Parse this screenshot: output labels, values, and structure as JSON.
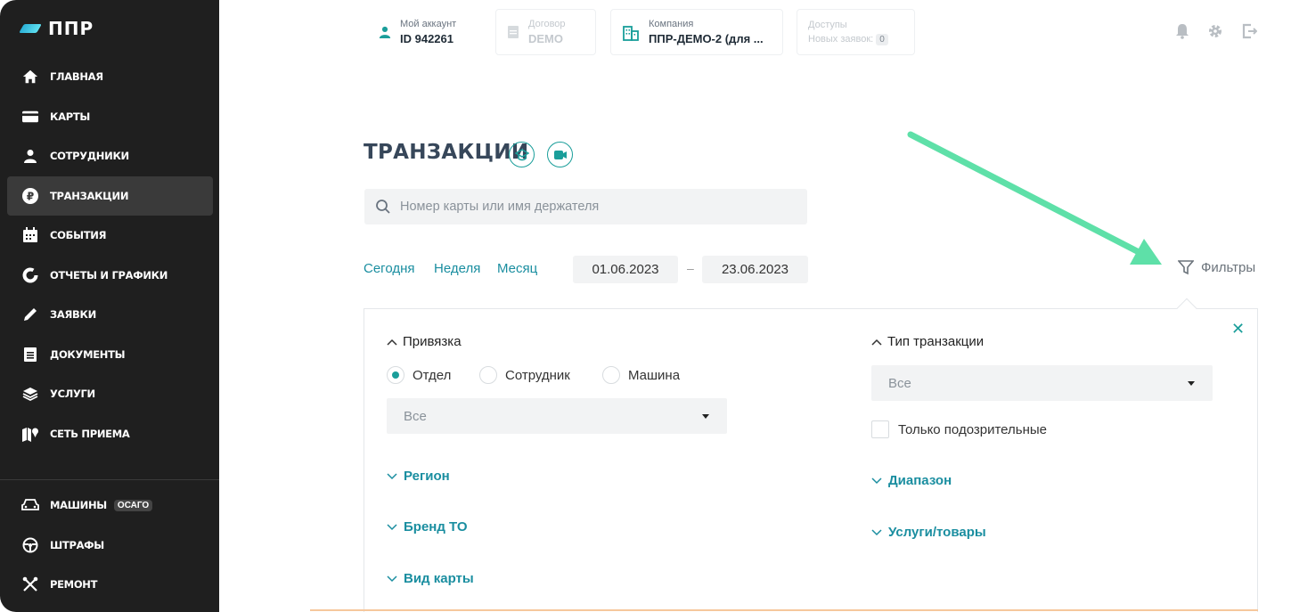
{
  "brand": {
    "logo_text": "ППР"
  },
  "sidebar": {
    "items": [
      {
        "label": "ГЛАВНАЯ",
        "icon": "home-icon"
      },
      {
        "label": "КАРТЫ",
        "icon": "card-icon"
      },
      {
        "label": "СОТРУДНИКИ",
        "icon": "user-icon"
      },
      {
        "label": "ТРАНЗАКЦИИ",
        "icon": "ruble-icon",
        "active": true
      },
      {
        "label": "СОБЫТИЯ",
        "icon": "calendar-icon"
      },
      {
        "label": "ОТЧЕТЫ И ГРАФИКИ",
        "icon": "donut-chart-icon"
      },
      {
        "label": "ЗАЯВКИ",
        "icon": "pencil-icon"
      },
      {
        "label": "ДОКУМЕНТЫ",
        "icon": "document-icon"
      },
      {
        "label": "УСЛУГИ",
        "icon": "layers-icon"
      },
      {
        "label": "СЕТЬ ПРИЕМА",
        "icon": "map-icon"
      }
    ],
    "bottom_items": [
      {
        "label": "МАШИНЫ",
        "badge": "ОСАГО",
        "icon": "car-icon"
      },
      {
        "label": "ШТРАФЫ",
        "icon": "steering-wheel-icon"
      },
      {
        "label": "РЕМОНТ",
        "icon": "tools-icon"
      }
    ]
  },
  "header": {
    "account": {
      "label": "Мой аккаунт",
      "value": "ID 942261"
    },
    "contract": {
      "label": "Договор",
      "value": "DEMO"
    },
    "company": {
      "label": "Компания",
      "value": "ППР-ДЕМО-2 (для ..."
    },
    "access": {
      "label": "Доступы",
      "sub": "Новых заявок:",
      "count": "0"
    }
  },
  "page": {
    "title": "ТРАНЗАКЦИИ",
    "search_placeholder": "Номер карты или имя держателя",
    "periods": [
      "Сегодня",
      "Неделя",
      "Месяц"
    ],
    "date_from": "01.06.2023",
    "date_separator": "–",
    "date_to": "23.06.2023",
    "filters_label": "Фильтры"
  },
  "filters": {
    "binding": {
      "title": "Привязка",
      "options": [
        "Отдел",
        "Сотрудник",
        "Машина"
      ],
      "selected": "Отдел",
      "select_value": "Все"
    },
    "left_links": [
      "Регион",
      "Бренд ТО",
      "Вид карты"
    ],
    "transaction_type": {
      "title": "Тип транзакции",
      "select_value": "Все"
    },
    "suspicious_only": {
      "label": "Только подозрительные",
      "checked": false
    },
    "right_links": [
      "Диапазон",
      "Услуги/товары"
    ]
  },
  "colors": {
    "accent": "#1a9e9a",
    "sidebar_bg": "#1f1f1f",
    "arrow": "#5ee0a8"
  }
}
